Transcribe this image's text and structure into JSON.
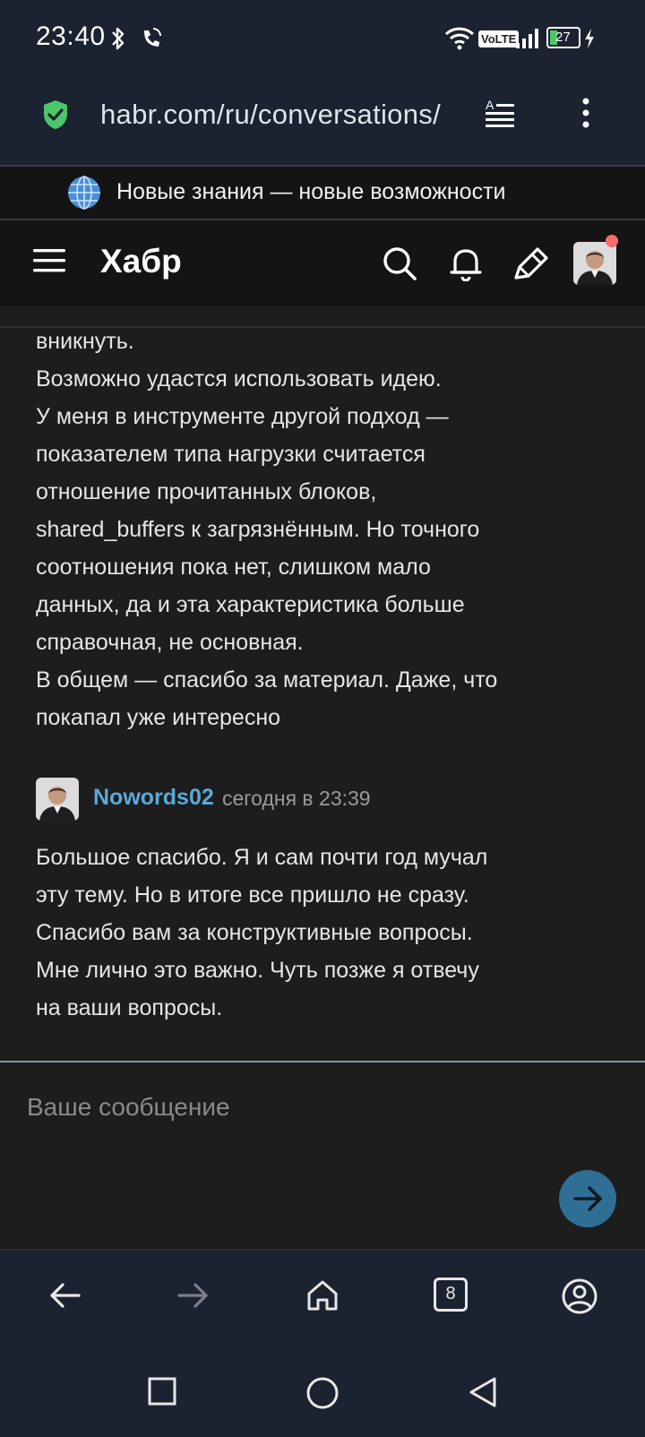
{
  "status_bar": {
    "time": "23:40",
    "network_label": "VoLTE",
    "battery": "27"
  },
  "browser": {
    "url": "habr.com/ru/conversations/",
    "tab_count": "8"
  },
  "promo": {
    "text": "Новые знания — новые возможности"
  },
  "site": {
    "logo": "Хабр"
  },
  "comments": [
    {
      "lines": [
        "вникнуть.",
        "Возможно удастся использовать идею.",
        "У меня в инструменте другой подход —",
        "показателем типа нагрузки считается",
        "отношение прочитанных блоков,",
        "shared_buffers к загрязнённым. Но точного",
        "соотношения пока нет, слишком мало",
        "данных, да и эта характеристика больше",
        "справочная, не основная.",
        "В общем — спасибо за материал. Даже, что",
        "покапал уже интересно"
      ]
    },
    {
      "author": "Nowords02",
      "time": "сегодня в 23:39",
      "lines": [
        "Большое спасибо. Я и сам почти год мучал",
        "эту тему. Но в итоге все пришло не сразу.",
        "Спасибо вам за конструктивные вопросы.",
        "Мне лично это важно. Чуть позже я отвечу",
        "на ваши вопросы."
      ]
    }
  ],
  "reply": {
    "placeholder": "Ваше сообщение"
  },
  "icons": {
    "status": [
      "bluetooth-icon",
      "wifi-call-icon",
      "wifi-icon",
      "signal-icon",
      "battery-icon",
      "charging-icon"
    ],
    "browser": [
      "shield-check-icon",
      "reader-mode-icon",
      "more-vertical-icon"
    ],
    "header": [
      "menu-icon",
      "search-icon",
      "bell-icon",
      "pen-icon",
      "user-avatar"
    ],
    "nav": [
      "back-arrow-icon",
      "forward-arrow-icon",
      "home-icon",
      "tabs-icon",
      "account-icon"
    ],
    "system": [
      "recents-square-icon",
      "home-circle-icon",
      "back-triangle-icon"
    ]
  },
  "colors": {
    "status_bar_bg": "#1b2230",
    "header_bg": "#141414",
    "content_bg": "#1d1d1d",
    "author_link": "#5aa9d8",
    "send_button": "#2f6f95",
    "notification_dot": "#ff6b6b",
    "secure_shield": "#4cc66a"
  }
}
